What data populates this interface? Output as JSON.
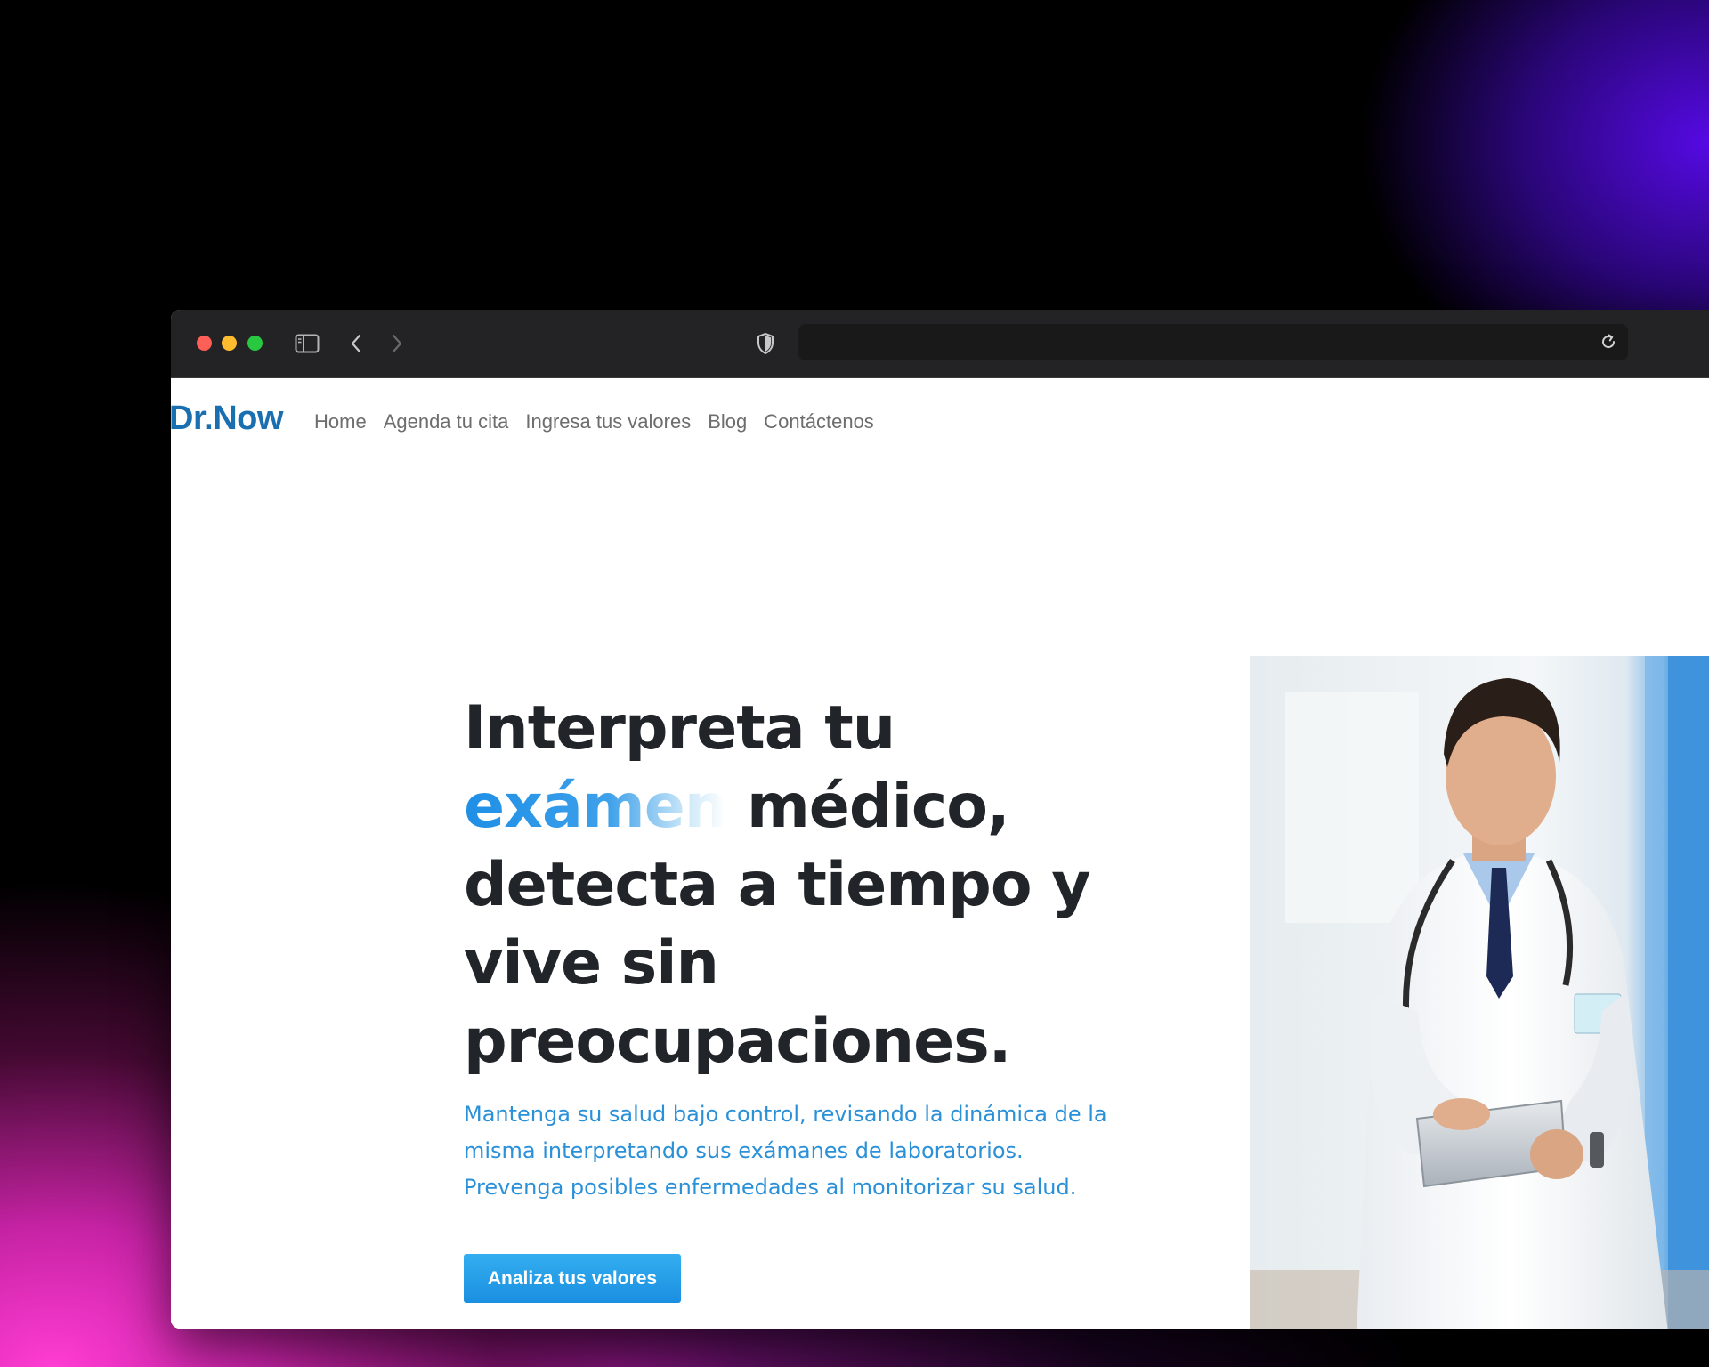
{
  "browser": {
    "address_value": ""
  },
  "site": {
    "brand": "Dr.Now",
    "nav": [
      "Home",
      "Agenda tu cita",
      "Ingresa tus valores",
      "Blog",
      "Contáctenos"
    ]
  },
  "hero": {
    "title_line1": "Interpreta tu",
    "title_highlight": "exámen",
    "title_rest": " médico, detecta a tiempo y vive sin preocupaciones.",
    "subtitle_lines": [
      "Mantenga su salud bajo control, revisando la dinámica de la",
      "misma interpretando sus exámanes de laboratorios.",
      "Prevenga posibles enfermedades al monitorizar su salud."
    ],
    "cta_label": "Analiza tus valores"
  },
  "colors": {
    "brand": "#1a6fb0",
    "accent": "#2a90d8",
    "button": "#1a8fe0",
    "heading": "#212529"
  },
  "icons": [
    "sidebar-icon",
    "back-arrow-icon",
    "forward-arrow-icon",
    "shield-icon",
    "reload-icon"
  ]
}
